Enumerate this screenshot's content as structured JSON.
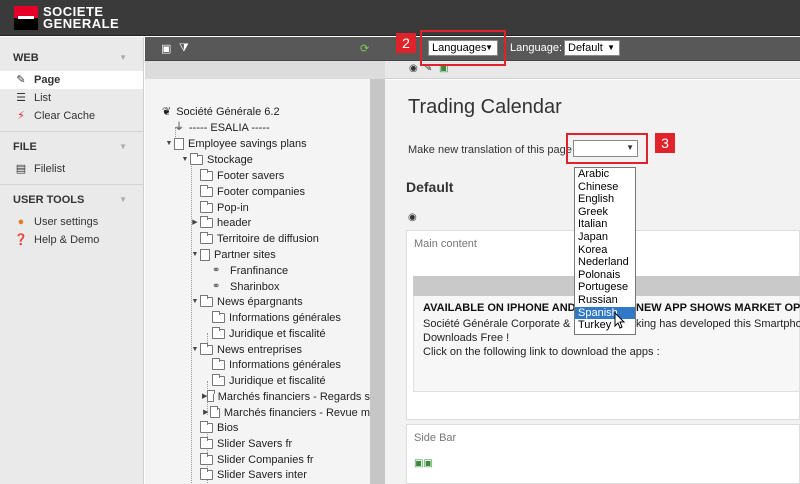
{
  "brand": {
    "line1": "SOCIETE",
    "line2": "GENERALE"
  },
  "left_menu": {
    "sections": [
      {
        "title": "WEB",
        "items": [
          {
            "label": "Page",
            "icon": "page-icon",
            "active": true
          },
          {
            "label": "List",
            "icon": "list-icon"
          },
          {
            "label": "Clear Cache",
            "icon": "flash-icon"
          }
        ]
      },
      {
        "title": "FILE",
        "items": [
          {
            "label": "Filelist",
            "icon": "filelist-icon"
          }
        ]
      },
      {
        "title": "USER TOOLS",
        "items": [
          {
            "label": "User settings",
            "icon": "user-icon"
          },
          {
            "label": "Help & Demo",
            "icon": "help-icon"
          }
        ]
      }
    ]
  },
  "toolbar": {
    "languages_select": "Languages",
    "language_label": "Language:",
    "language_value": "Default",
    "marker_2": "2",
    "marker_3": "3"
  },
  "tree": {
    "nodes": [
      {
        "label": "Société Générale 6.2"
      },
      {
        "label": "----- ESALIA -----"
      },
      {
        "label": "Employee savings plans"
      },
      {
        "label": "Stockage"
      },
      {
        "label": "Footer savers"
      },
      {
        "label": "Footer companies"
      },
      {
        "label": "Pop-in"
      },
      {
        "label": "header"
      },
      {
        "label": "Territoire de diffusion"
      },
      {
        "label": "Partner sites"
      },
      {
        "label": "Franfinance"
      },
      {
        "label": "Sharinbox"
      },
      {
        "label": "News épargnants"
      },
      {
        "label": "Informations générales"
      },
      {
        "label": "Juridique et fiscalité"
      },
      {
        "label": "News entreprises"
      },
      {
        "label": "Informations générales"
      },
      {
        "label": "Juridique et fiscalité"
      },
      {
        "label": "Marchés financiers - Regards s"
      },
      {
        "label": "Marchés financiers - Revue m"
      },
      {
        "label": "Bios"
      },
      {
        "label": "Slider Savers fr"
      },
      {
        "label": "Slider Companies fr"
      },
      {
        "label": "Slider Savers inter"
      }
    ]
  },
  "content": {
    "title": "Trading Calendar",
    "translation_label": "Make new translation of this page",
    "default_heading": "Default",
    "main_content_label": "Main content",
    "ce_title": "AVAILABLE ON IPHONE AND",
    "ce_title_right": "NEW APP SHOWS MARKET OPE",
    "ce_line1_left": "Société Générale Corporate & In",
    "ce_line1_right": "king has developed this Smartpho",
    "ce_line2": "Downloads Free !",
    "ce_line3": "Click on the following link to download the apps :",
    "sidebar_label": "Side Bar"
  },
  "language_options": [
    "Arabic",
    "Chinese",
    "English",
    "Greek",
    "Italian",
    "Japan",
    "Korea",
    "Nederland",
    "Polonais",
    "Portugese",
    "Russian",
    "Spanish",
    "Turkey"
  ],
  "highlighted_option": "Spanish",
  "colors": {
    "accent_red": "#e0232a",
    "brand_red": "#e60028",
    "highlight_blue": "#3178c6"
  }
}
